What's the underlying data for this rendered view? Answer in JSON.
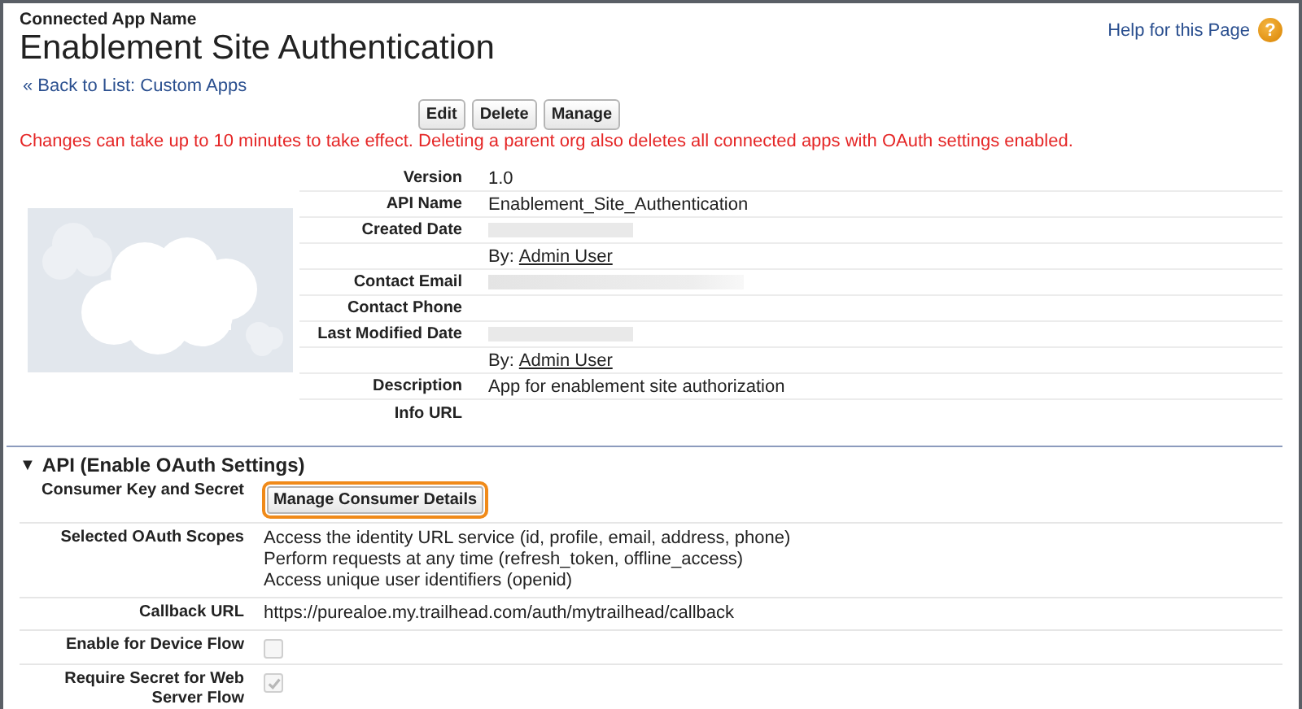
{
  "header": {
    "eyebrow": "Connected App Name",
    "title": "Enablement Site Authentication",
    "help_link": "Help for this Page",
    "help_icon": "?"
  },
  "back_link": "« Back to List: Custom Apps",
  "buttons": [
    "Edit",
    "Delete",
    "Manage"
  ],
  "warning": "Changes can take up to 10 minutes to take effect. Deleting a parent org also deletes all connected apps with OAuth settings enabled.",
  "details": [
    {
      "label": "Version",
      "kind": "text",
      "value": "1.0"
    },
    {
      "label": "API Name",
      "kind": "text",
      "value": "Enablement_Site_Authentication"
    },
    {
      "label": "Created Date",
      "kind": "redacted"
    },
    {
      "kind": "by",
      "prefix": "By:",
      "value": "Admin User"
    },
    {
      "label": "Contact Email",
      "kind": "redacted_long"
    },
    {
      "label": "Contact Phone",
      "kind": "empty"
    },
    {
      "label": "Last Modified Date",
      "kind": "redacted"
    },
    {
      "kind": "by",
      "prefix": "By:",
      "value": "Admin User"
    },
    {
      "label": "Description",
      "kind": "text",
      "value": "App for enablement site authorization"
    },
    {
      "label": "Info URL",
      "kind": "empty"
    }
  ],
  "oauth_section": {
    "toggle": "▼",
    "title": "API (Enable OAuth Settings)",
    "expanded": true,
    "rows": [
      {
        "label": "Consumer Key and Secret",
        "kind": "button",
        "value": "Manage Consumer Details",
        "highlighted": true
      },
      {
        "label": "Selected OAuth Scopes",
        "kind": "lines",
        "lines": [
          "Access the identity URL service (id, profile, email, address, phone)",
          "Perform requests at any time (refresh_token, offline_access)",
          "Access unique user identifiers (openid)"
        ]
      },
      {
        "label": "Callback URL",
        "kind": "text",
        "value": "https://purealoe.my.trailhead.com/auth/mytrailhead/callback"
      },
      {
        "label": "Enable for Device Flow",
        "kind": "checkbox",
        "checked": false
      },
      {
        "label": "Require Secret for Web Server Flow",
        "kind": "checkbox",
        "checked": true
      }
    ]
  }
}
